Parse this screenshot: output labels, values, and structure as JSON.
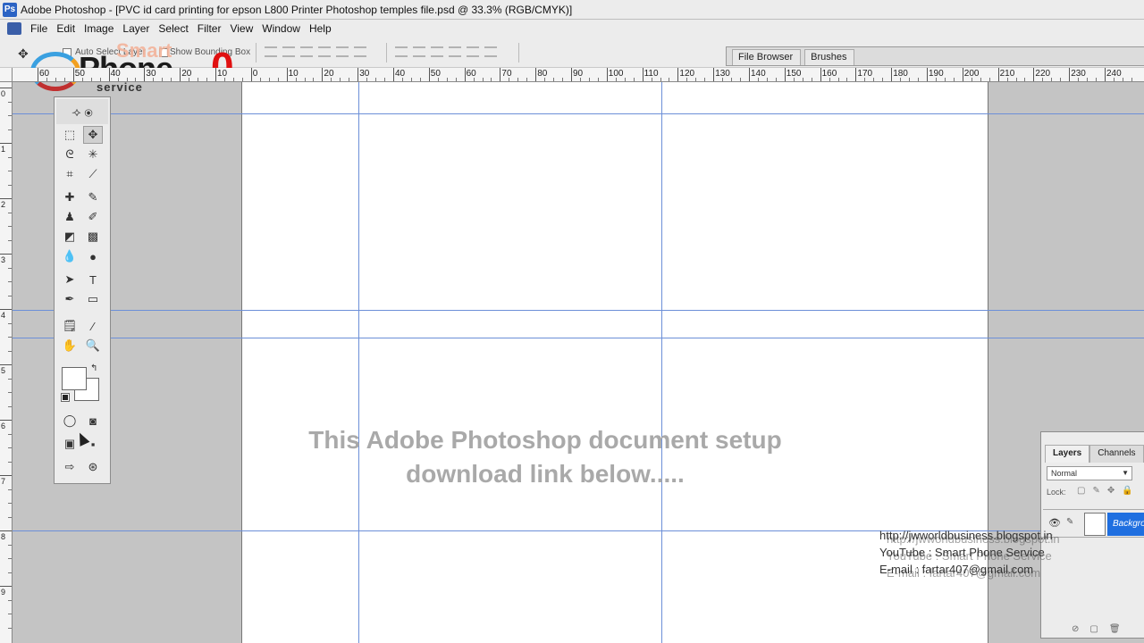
{
  "window": {
    "title": "Adobe Photoshop - [PVC id card printing  for epson L800 Printer Photoshop temples file.psd @ 33.3% (RGB/CMYK)]",
    "app_icon_glyph": "Ps"
  },
  "menu": {
    "items": [
      "File",
      "Edit",
      "Image",
      "Layer",
      "Select",
      "Filter",
      "View",
      "Window",
      "Help"
    ]
  },
  "options_bar": {
    "auto_select_label": "Auto Select Layer",
    "bounding_box_label": "Show Bounding Box",
    "icons": [
      "move-tool-icon",
      "align-icon",
      "distribute-icon"
    ]
  },
  "palette_well": {
    "tabs": [
      "File Browser",
      "Brushes"
    ]
  },
  "logo": {
    "smart": "Smart",
    "phone": "Phone",
    "zero": "0",
    "service": "service"
  },
  "rulers": {
    "horizontal_labels": [
      "60",
      "50",
      "40",
      "30",
      "20",
      "10",
      "0",
      "10",
      "20",
      "30",
      "40",
      "50",
      "60",
      "70",
      "80",
      "90",
      "100",
      "110",
      "120",
      "130",
      "140",
      "150",
      "160",
      "170",
      "180",
      "190",
      "200",
      "210",
      "220",
      "230",
      "240"
    ],
    "vertical_labels": [
      "0",
      "1",
      "2",
      "3",
      "4",
      "5",
      "6",
      "7",
      "8",
      "9"
    ]
  },
  "canvas": {
    "overlay_line1": "This Adobe Photoshop document setup",
    "overlay_line2": "download link below....."
  },
  "toolbox": {
    "tools": [
      {
        "name": "marquee-tool-icon",
        "glyph": "⬚"
      },
      {
        "name": "move-tool-icon",
        "glyph": "✥"
      },
      {
        "name": "lasso-tool-icon",
        "glyph": "ᘓ"
      },
      {
        "name": "magic-wand-tool-icon",
        "glyph": "✳"
      },
      {
        "name": "crop-tool-icon",
        "glyph": "⌗"
      },
      {
        "name": "slice-tool-icon",
        "glyph": "⟋"
      },
      {
        "name": "healing-brush-tool-icon",
        "glyph": "✚"
      },
      {
        "name": "brush-tool-icon",
        "glyph": "✎"
      },
      {
        "name": "clone-stamp-tool-icon",
        "glyph": "♟"
      },
      {
        "name": "history-brush-tool-icon",
        "glyph": "✐"
      },
      {
        "name": "eraser-tool-icon",
        "glyph": "◩"
      },
      {
        "name": "gradient-tool-icon",
        "glyph": "▩"
      },
      {
        "name": "blur-tool-icon",
        "glyph": "💧"
      },
      {
        "name": "dodge-tool-icon",
        "glyph": "●"
      },
      {
        "name": "path-selection-tool-icon",
        "glyph": "➤"
      },
      {
        "name": "type-tool-icon",
        "glyph": "T"
      },
      {
        "name": "pen-tool-icon",
        "glyph": "✒"
      },
      {
        "name": "shape-tool-icon",
        "glyph": "▭"
      },
      {
        "name": "notes-tool-icon",
        "glyph": "🗒"
      },
      {
        "name": "eyedropper-tool-icon",
        "glyph": "⁄"
      },
      {
        "name": "hand-tool-icon",
        "glyph": "✋"
      },
      {
        "name": "zoom-tool-icon",
        "glyph": "🔍"
      },
      {
        "name": "standard-mode-icon",
        "glyph": "◯"
      },
      {
        "name": "quick-mask-mode-icon",
        "glyph": "◙"
      },
      {
        "name": "screen-mode-standard-icon",
        "glyph": "▣"
      },
      {
        "name": "screen-mode-full-icon",
        "glyph": "▪"
      },
      {
        "name": "jump-to-imageready-icon",
        "glyph": "⇨"
      },
      {
        "name": "jump-to-web-icon",
        "glyph": "⊛"
      }
    ],
    "swap_glyph": "↰"
  },
  "layers_panel": {
    "tabs": [
      "Layers",
      "Channels"
    ],
    "blend_mode": "Normal",
    "lock_label": "Lock:",
    "layer_name": "Backgro"
  },
  "watermark": {
    "line1": "http://jwworldbusiness.blogspot.in",
    "line2": "YouTube : Smart Phone Service",
    "line3": "E-mail : fartar407@gmail.com"
  }
}
